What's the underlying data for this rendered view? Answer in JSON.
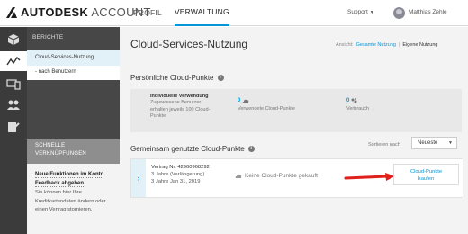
{
  "header": {
    "logo_brand": "AUTODESK",
    "logo_suffix": "ACCOUNT",
    "nav": [
      {
        "label": "PROFIL",
        "active": false
      },
      {
        "label": "VERWALTUNG",
        "active": true
      }
    ],
    "support_label": "Support",
    "user_name": "Matthias Zehle"
  },
  "icon_rail": [
    "cube-icon",
    "chart-line-icon",
    "devices-icon",
    "users-icon",
    "edit-document-icon"
  ],
  "sidebar": {
    "section": "BERICHTE",
    "items": [
      {
        "label": "Cloud-Services-Nutzung",
        "active": true
      },
      {
        "label": "- nach Benutzern",
        "active": false
      }
    ],
    "quick_links": {
      "header_line1": "SCHNELLE",
      "header_line2": "VERKNÜPFUNGEN",
      "link1": "Neue Funktionen im Konto",
      "link2": "Feedback abgeben",
      "desc_line1": "Sie können hier Ihre",
      "desc_line2": "Kreditkartendaten ändern oder",
      "desc_line3": "einen Vertrag stornieren."
    }
  },
  "main": {
    "title": "Cloud-Services-Nutzung",
    "view_label": "Ansicht:",
    "view_selected": "Gesamte Nutzung",
    "view_separator": "|",
    "view_other": "Eigene Nutzung",
    "personal": {
      "title": "Persönliche Cloud-Punkte",
      "usage_title": "Individuelle Verwendung",
      "usage_desc_line1": "Zugewiesene Benutzer",
      "usage_desc_line2": "erhalten jeweils 100 Cloud-",
      "usage_desc_line3": "Punkte",
      "used_value": "0",
      "used_label": "Verwendete Cloud-Punkte",
      "consumption_value": "0",
      "consumption_label": "Verbrauch"
    },
    "shared": {
      "title": "Gemeinsam genutzte Cloud-Punkte",
      "sort_label": "Sortieren nach",
      "sort_value": "Neueste",
      "contract": {
        "line1": "Vertrag Nr. 42960968292",
        "line2": "3 Jahre (Verlängerung)",
        "line3": "3 Jahre Jan 31, 2019",
        "status": "Keine Cloud-Punkte gekauft",
        "buy_line1": "Cloud-Punkte",
        "buy_line2": "kaufen"
      }
    }
  },
  "colors": {
    "accent": "#0696d7",
    "arrow": "#e0201b",
    "rail": "#3b3b3b",
    "sidebar": "#474747"
  }
}
